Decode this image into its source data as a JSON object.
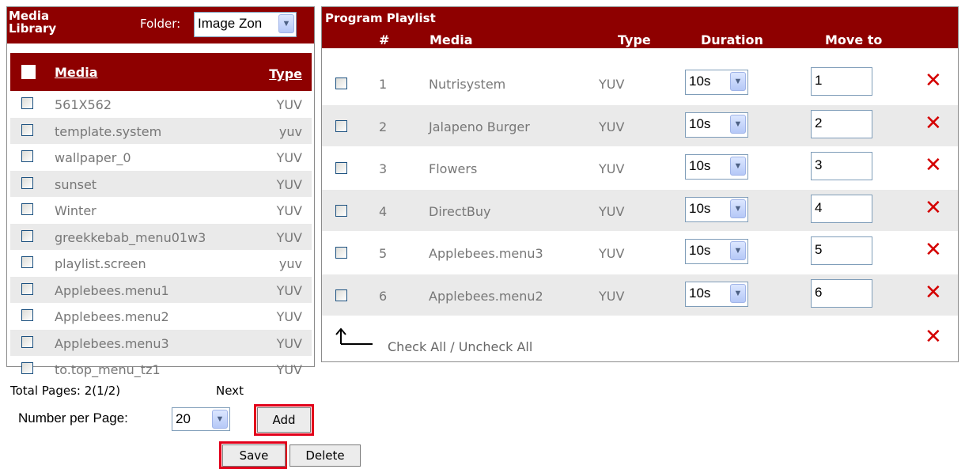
{
  "library": {
    "title": "Media Library",
    "folder_label": "Folder:",
    "folder_value": "Image Zon",
    "columns": {
      "media": "Media",
      "type": "Type"
    },
    "rows": [
      {
        "name": "561X562",
        "type": "YUV"
      },
      {
        "name": "template.system",
        "type": "yuv"
      },
      {
        "name": "wallpaper_0",
        "type": "YUV"
      },
      {
        "name": "sunset",
        "type": "YUV"
      },
      {
        "name": "Winter",
        "type": "YUV"
      },
      {
        "name": "greekkebab_menu01w3",
        "type": "YUV"
      },
      {
        "name": "playlist.screen",
        "type": "yuv"
      },
      {
        "name": "Applebees.menu1",
        "type": "YUV"
      },
      {
        "name": "Applebees.menu2",
        "type": "YUV"
      },
      {
        "name": "Applebees.menu3",
        "type": "YUV"
      },
      {
        "name": "to.top_menu_tz1",
        "type": "YUV"
      }
    ],
    "total_pages": "Total Pages: 2(1/2)",
    "next": "Next",
    "per_page_label": "Number per Page:",
    "per_page_value": "20",
    "add_label": "Add"
  },
  "playlist": {
    "title": "Program Playlist",
    "columns": {
      "num": "#",
      "media": "Media",
      "type": "Type",
      "duration": "Duration",
      "move_to": "Move to"
    },
    "rows": [
      {
        "num": "1",
        "media": "Nutrisystem",
        "type": "YUV",
        "duration": "10s",
        "move_to": "1"
      },
      {
        "num": "2",
        "media": "Jalapeno Burger",
        "type": "YUV",
        "duration": "10s",
        "move_to": "2"
      },
      {
        "num": "3",
        "media": "Flowers",
        "type": "YUV",
        "duration": "10s",
        "move_to": "3"
      },
      {
        "num": "4",
        "media": "DirectBuy",
        "type": "YUV",
        "duration": "10s",
        "move_to": "4"
      },
      {
        "num": "5",
        "media": "Applebees.menu3",
        "type": "YUV",
        "duration": "10s",
        "move_to": "5"
      },
      {
        "num": "6",
        "media": "Applebees.menu2",
        "type": "YUV",
        "duration": "10s",
        "move_to": "6"
      }
    ],
    "check_all": "Check All / Uncheck All"
  },
  "actions": {
    "save": "Save",
    "delete": "Delete"
  },
  "colors": {
    "header": "#8e0000",
    "delete_x": "#d40000",
    "highlight": "#e2001a"
  }
}
